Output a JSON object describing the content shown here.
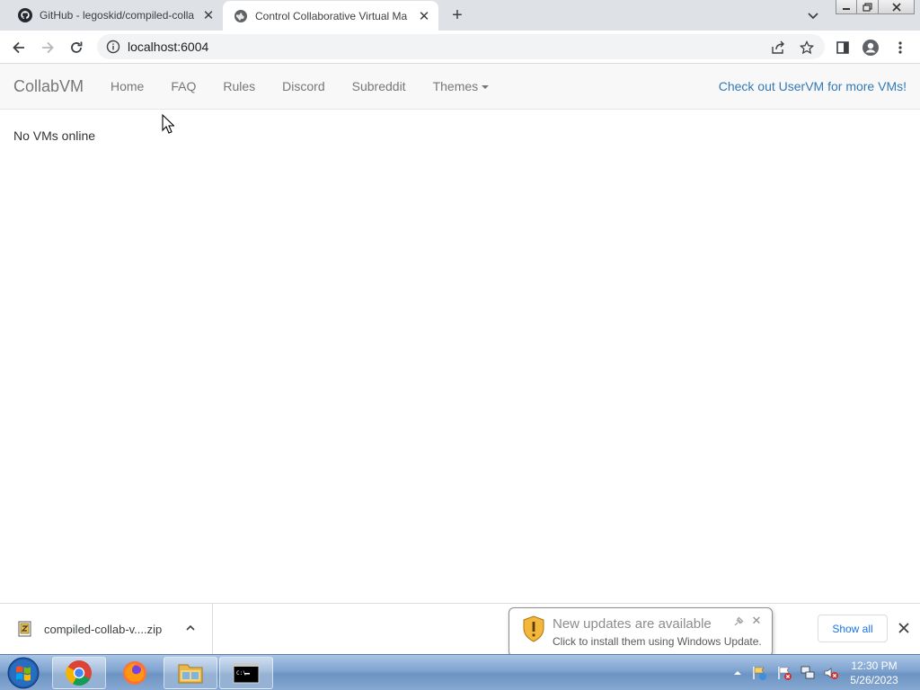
{
  "browser": {
    "tabs": [
      {
        "title": "GitHub - legoskid/compiled-colla",
        "favicon": "github-icon",
        "active": false
      },
      {
        "title": "Control Collaborative Virtual Ma",
        "favicon": "globe-icon",
        "active": true
      }
    ],
    "url": "localhost:6004"
  },
  "page": {
    "brand": "CollabVM",
    "nav": [
      "Home",
      "FAQ",
      "Rules",
      "Discord",
      "Subreddit",
      "Themes"
    ],
    "nav_right": "Check out UserVM for more VMs!",
    "body_text": "No VMs online"
  },
  "downloads": {
    "file_name": "compiled-collab-v....zip",
    "show_all": "Show all"
  },
  "notification": {
    "title": "New updates are available",
    "text": "Click to install them using Windows Update."
  },
  "taskbar": {
    "apps": [
      "chrome-icon",
      "firefox-icon",
      "explorer-icon",
      "cmd-icon"
    ],
    "time": "12:30 PM",
    "date": "5/26/2023"
  },
  "colors": {
    "accent_link": "#337ab7",
    "navbar_bg": "#f8f8f8",
    "tabstrip_bg": "#dee1e6"
  }
}
